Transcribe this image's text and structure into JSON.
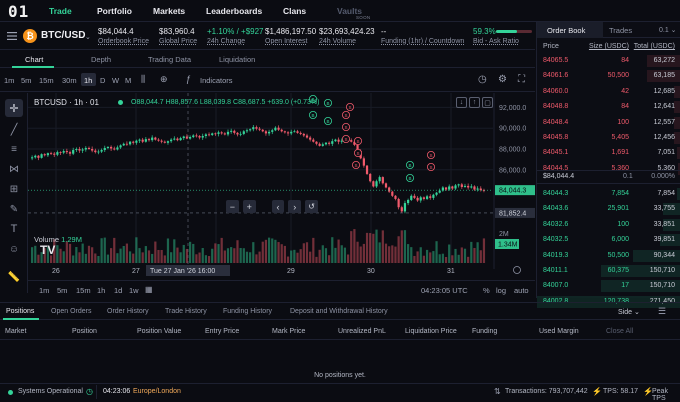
{
  "nav": {
    "logo": "01",
    "items": [
      "Trade",
      "Portfolio",
      "Markets",
      "Leaderboards",
      "Clans",
      "Vaults"
    ],
    "soon": "SOON"
  },
  "ticker": {
    "symbol": "BTC/USD",
    "orderbook_price": "$84,044.4",
    "orderbook_price_label": "Orderbook Price",
    "global_price": "$83,960.4",
    "global_price_label": "Global Price",
    "change": "+1.10% / +$927",
    "change_label": "24h Change",
    "open_interest": "$1,486,197.50",
    "open_interest_label": "Open Interest",
    "volume": "$23,693,424.23",
    "volume_label": "24h Volume",
    "funding": "--",
    "funding_label": "Funding (1hr) / Countdown",
    "bid_pct": "59.3%",
    "bid_ask_label": "Bid - Ask Ratio",
    "bid_ratio": 0.593
  },
  "tabs": [
    "Chart",
    "Depth",
    "Trading Data",
    "Liquidation"
  ],
  "toolbar": {
    "timeframes": [
      "1m",
      "5m",
      "15m",
      "30m",
      "1h",
      "D",
      "W",
      "M"
    ],
    "active": "1h",
    "indicators": "Indicators"
  },
  "chart": {
    "legend_symbol": "BTCUSD · 1h · 01",
    "legend_o": "O88,044.7",
    "legend_h": "H88,857.6",
    "legend_l": "L88,039.8",
    "legend_c": "C88,687.5",
    "legend_chg": "+639.0 (+0.73%)",
    "volume_label": "Volume",
    "volume_value": "1.29M",
    "price_ticks": [
      "92,000.0",
      "90,000.0",
      "88,000.0",
      "86,000.0",
      "84,044.3",
      "81,852.4"
    ],
    "price_tag": "84,044.3",
    "cursor_price": "81,852.4",
    "vol_tick": "2M",
    "vol_tag": "1.34M",
    "date_ticks": [
      "26",
      "27",
      "29",
      "30",
      "31"
    ],
    "cursor_date": "Tue 27 Jan '26  16:00",
    "bottom_ranges": [
      "1m",
      "5m",
      "15m",
      "1h",
      "1d",
      "1w"
    ],
    "time": "04:23:05 UTC",
    "pct": "%",
    "log": "log",
    "auto": "auto"
  },
  "orderbook": {
    "tabs": [
      "Order Book",
      "Trades"
    ],
    "precision": "0.1",
    "headers": [
      "Price",
      "Size (USDC)",
      "Total (USDC)"
    ],
    "asks": [
      [
        "84065.5",
        "84",
        "63,272"
      ],
      [
        "84061.6",
        "50,500",
        "63,185"
      ],
      [
        "84060.0",
        "42",
        "12,685"
      ],
      [
        "84048.8",
        "84",
        "12,641"
      ],
      [
        "84048.4",
        "100",
        "12,557"
      ],
      [
        "84045.8",
        "5,405",
        "12,456"
      ],
      [
        "84045.1",
        "1,691",
        "7,051"
      ],
      [
        "84044.5",
        "5,360",
        "5,360"
      ]
    ],
    "mid_price": "$84,044.4",
    "spread": "0.1",
    "spread_pct": "0.000%",
    "bids": [
      [
        "84044.3",
        "7,854",
        "7,854"
      ],
      [
        "84043.6",
        "25,901",
        "33,755"
      ],
      [
        "84032.6",
        "100",
        "33,851"
      ],
      [
        "84032.5",
        "6,000",
        "39,851"
      ],
      [
        "84019.3",
        "50,500",
        "90,344"
      ],
      [
        "84011.1",
        "60,375",
        "150,710"
      ],
      [
        "84007.0",
        "17",
        "150,710"
      ],
      [
        "84002.8",
        "120,738",
        "271,450"
      ]
    ]
  },
  "positions": {
    "tabs": [
      "Positions",
      "Open Orders",
      "Order History",
      "Trade History",
      "Funding History",
      "Deposit and Withdrawal History"
    ],
    "side_filter": "Side",
    "headers": [
      "Market",
      "Position",
      "Position Value",
      "Entry Price",
      "Mark Price",
      "Unrealized PnL",
      "Liquidation Price",
      "Funding",
      "Used Margin",
      "Close All"
    ],
    "empty": "No positions yet."
  },
  "status": {
    "system": "Systems Operational",
    "time": "04:23:06",
    "tz": "Europe/London",
    "transactions": "Transactions: 793,707,442",
    "tps": "TPS: 58.17",
    "peak": "Peak TPS"
  },
  "colors": {
    "green": "#34d399",
    "red": "#f05a6b",
    "accent": "#2fbf8a"
  },
  "chart_data": {
    "type": "candlestick",
    "y_range": [
      80500,
      93000
    ],
    "candles_close": [
      87200,
      87350,
      87150,
      87500,
      87400,
      87600,
      87550,
      87450,
      87700,
      87650,
      87800,
      87700,
      87550,
      87900,
      88000,
      87850,
      87950,
      88100,
      88000,
      87850,
      87700,
      87750,
      87900,
      88100,
      88200,
      88050,
      87950,
      88150,
      88350,
      88500,
      88450,
      88700,
      88600,
      88800,
      88900,
      88700,
      88950,
      88850,
      89100,
      88900,
      88800,
      88700,
      88600,
      88750,
      88900,
      89000,
      88850,
      89050,
      89200,
      89000,
      89150,
      89300,
      89250,
      89100,
      89250,
      89400,
      89350,
      89500,
      89450,
      89600,
      89500,
      89400,
      89650,
      89750,
      89550,
      89400,
      89450,
      89700,
      89800,
      89900,
      90100,
      89950,
      89850,
      89700,
      89500,
      89650,
      89800,
      90050,
      89850,
      89700,
      89600,
      89500,
      89650,
      89700,
      89550,
      89450,
      89300,
      89100,
      88900,
      88700,
      88500,
      88300,
      88450,
      88600,
      88500,
      88750,
      88900,
      88700,
      88800,
      88950,
      88850,
      88700,
      88400,
      87800,
      87100,
      86400,
      85600,
      84900,
      84400,
      84900,
      85300,
      84700,
      84300,
      83900,
      83500,
      83200,
      82400,
      82000,
      82800,
      83100,
      83500,
      83300,
      83050,
      83350,
      83200,
      83450,
      83300,
      83600,
      83800,
      84000,
      84300,
      84100,
      84400,
      84200,
      84500,
      84600,
      84350,
      84450,
      84300,
      84400,
      84100,
      84200,
      84050,
      84044
    ]
  }
}
